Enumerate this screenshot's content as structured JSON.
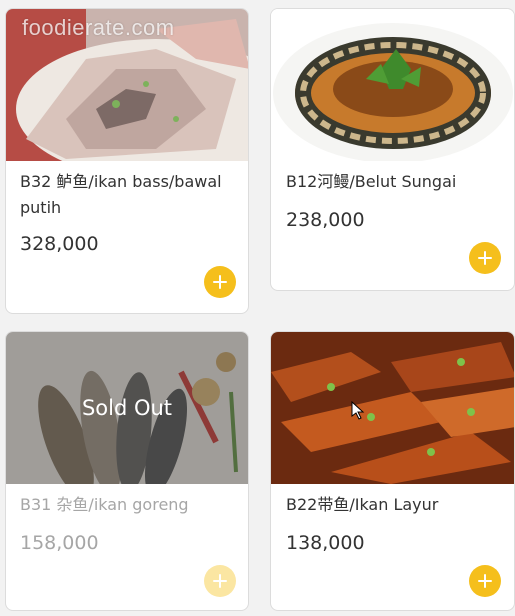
{
  "watermark": "foodierate.com",
  "sold_out_label": "Sold Out",
  "colors": {
    "accent": "#f5bf1c",
    "accent_disabled": "#fbe6a2"
  },
  "items": [
    {
      "title": "B32 鲈鱼/ikan bass/bawal putih",
      "price": "328,000",
      "sold_out": false
    },
    {
      "title": "B12河鳗/Belut Sungai",
      "price": "238,000",
      "sold_out": false
    },
    {
      "title": "B31 杂鱼/ikan goreng",
      "price": "158,000",
      "sold_out": true
    },
    {
      "title": "B22带鱼/Ikan Layur",
      "price": "138,000",
      "sold_out": false
    }
  ]
}
